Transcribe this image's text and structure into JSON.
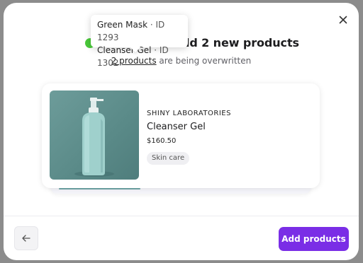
{
  "modal": {
    "title": "dd 2 new products",
    "subtitle_link": "2 products",
    "subtitle_rest": " are being overwritten"
  },
  "tooltip": {
    "items": [
      {
        "name": "Green Mask",
        "sep": " · ",
        "id": "ID 1293"
      },
      {
        "name": "Cleanser Gel",
        "sep": " · ",
        "id": "ID 1302"
      }
    ]
  },
  "product": {
    "brand": "SHINY LABORATORIES",
    "name": "Cleanser Gel",
    "price": "$160.50",
    "tag": "Skin care"
  },
  "footer": {
    "add_label": "Add products"
  },
  "colors": {
    "accent": "#7a2ee6",
    "status_green": "#4ac93a"
  },
  "icons": {
    "close": "close-icon",
    "back": "arrow-left-icon"
  }
}
